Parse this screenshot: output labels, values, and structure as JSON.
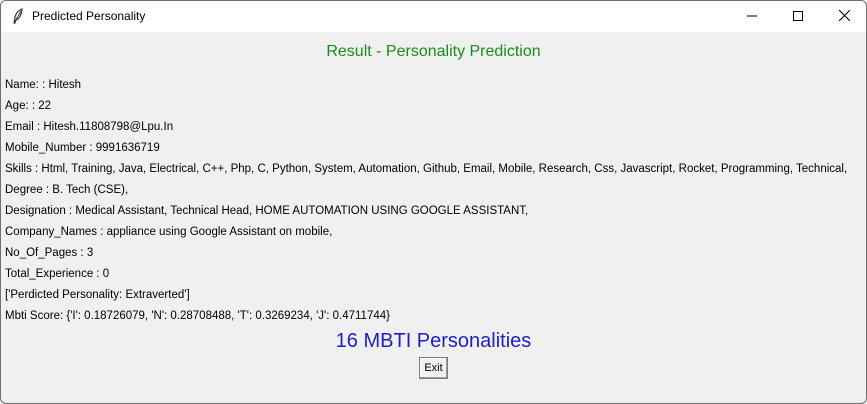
{
  "window": {
    "title": "Predicted Personality",
    "icon": "feather-icon"
  },
  "controls": {
    "minimize": "minimize-icon",
    "maximize": "maximize-icon",
    "close": "close-icon"
  },
  "heading": "Result - Personality Prediction",
  "details": [
    "Name: : Hitesh",
    "Age: : 22",
    "Email : Hitesh.11808798@Lpu.In",
    "Mobile_Number : 9991636719",
    "Skills : Html, Training, Java, Electrical, C++, Php, C, Python, System, Automation, Github, Email, Mobile, Research, Css, Javascript, Rocket, Programming, Technical,",
    "Degree : B. Tech (CSE),",
    "Designation : Medical Assistant, Technical Head, HOME AUTOMATION USING GOOGLE ASSISTANT,",
    "Company_Names : appliance using Google Assistant on mobile,",
    "No_Of_Pages : 3",
    "Total_Experience : 0",
    "['Perdicted Personality: Extraverted']",
    "Mbti Score: {'I': 0.18726079, 'N': 0.28708488, 'T': 0.3269234, 'J': 0.4711744}"
  ],
  "subheading": "16 MBTI Personalities",
  "exit_label": "Exit",
  "colors": {
    "heading": "#1a8c1a",
    "subheading": "#1e1ec8",
    "background": "#f0f0f0"
  }
}
